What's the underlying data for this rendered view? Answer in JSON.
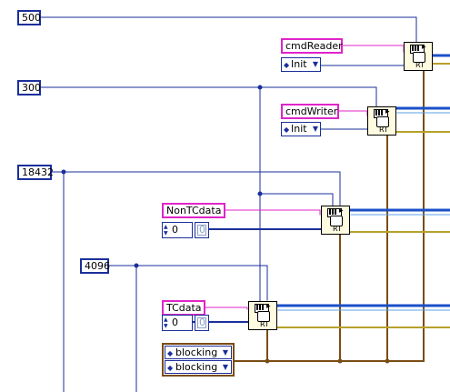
{
  "constants": {
    "c500": "500",
    "c300": "300",
    "c18432": "18432",
    "c4096": "4096"
  },
  "queues": {
    "cmdReader": {
      "name": "cmdReader",
      "mode": "Init"
    },
    "cmdWriter": {
      "name": "cmdWriter",
      "mode": "Init"
    },
    "NonTCdata": {
      "name": "NonTCdata",
      "index": "0",
      "element": "0"
    },
    "TCdata": {
      "name": "TCdata",
      "index": "0",
      "element": "0"
    }
  },
  "enum": {
    "row1": "blocking",
    "row2": "blocking"
  },
  "vi_label": "RT",
  "colors": {
    "numeric_wire": "#1a2f9b",
    "string_wire": "#e024c8",
    "enum_wire": "#7a4d13",
    "cluster_wire": "#b7a12a"
  },
  "icons": {
    "queue_vi": "rt-fifo-create-icon",
    "ring_arrow": "ring-arrows-icon",
    "dropdown": "chevron-down-icon"
  }
}
